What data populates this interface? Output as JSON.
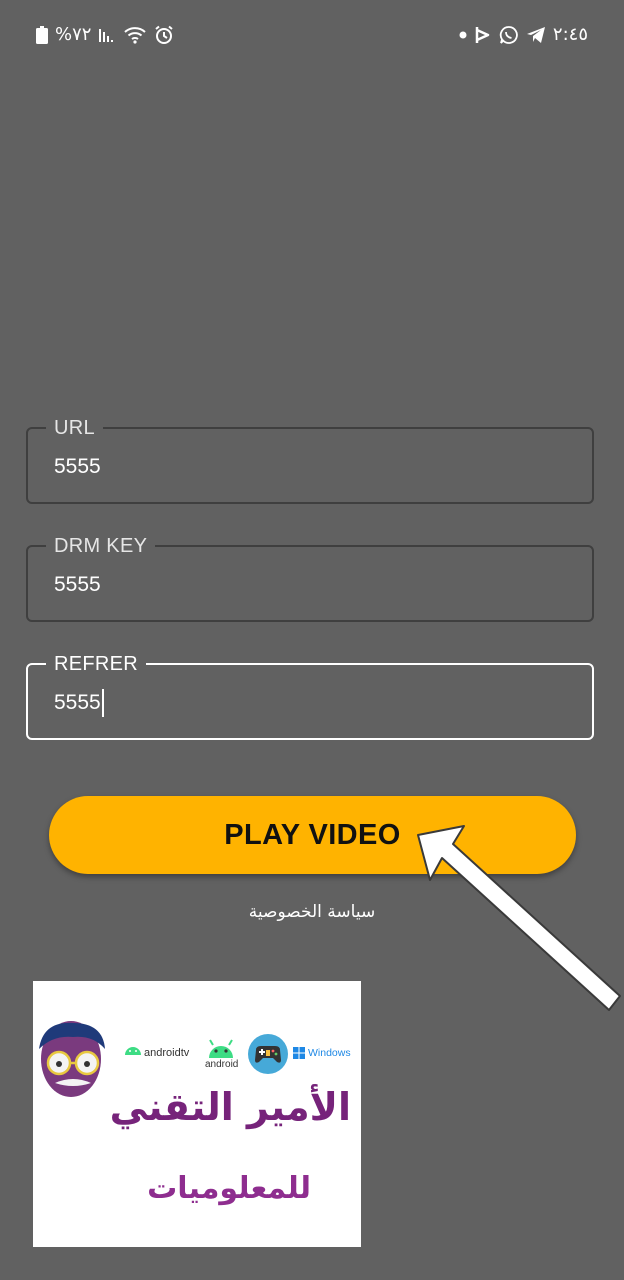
{
  "status_bar": {
    "battery": "%٧٢",
    "time": "٢:٤٥"
  },
  "form": {
    "fields": [
      {
        "label": "URL",
        "value": "5555",
        "focused": false
      },
      {
        "label": "DRM KEY",
        "value": "5555",
        "focused": false
      },
      {
        "label": "REFRER",
        "value": "5555",
        "focused": true
      }
    ],
    "play_button_label": "PLAY VIDEO",
    "privacy_link": "سياسة الخصوصية"
  },
  "logo": {
    "title": "الأمير التقني",
    "subtitle": "للمعلوميات",
    "tags": [
      "androidtv",
      "android",
      "Windows"
    ]
  },
  "colors": {
    "background": "#616161",
    "accent": "#ffb300",
    "logo_text": "#76237a"
  },
  "icons": [
    "battery-icon",
    "signal-icon",
    "wifi-icon",
    "alarm-icon",
    "dot-icon",
    "nfc-icon",
    "whatsapp-icon",
    "telegram-icon",
    "pointer-arrow-icon"
  ]
}
